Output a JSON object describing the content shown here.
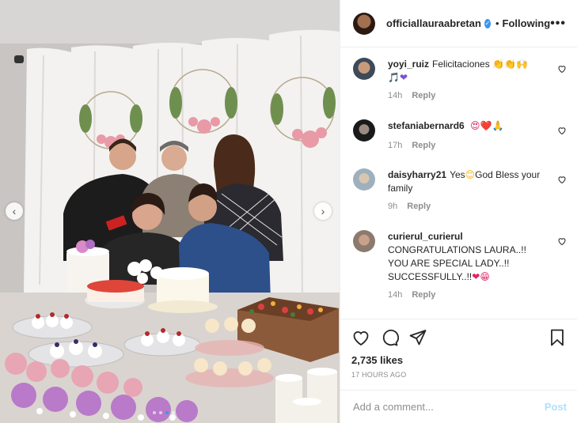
{
  "post": {
    "photo_alt": "",
    "carousel": {
      "prev": "‹",
      "next": "›"
    }
  },
  "header": {
    "username": "officiallauraabretan",
    "separator": "•",
    "follow_status": "Following",
    "more": "•••"
  },
  "comments": [
    {
      "user": "yoyi_ruiz",
      "text": "Felicitaciones",
      "emoji_after": "👏👏🙌",
      "line2": "🎵❤",
      "time": "14h",
      "reply": "Reply"
    },
    {
      "user": "stefaniabernard6",
      "text": "",
      "emoji_after": "😍❤️🙏",
      "line2": "",
      "time": "17h",
      "reply": "Reply"
    },
    {
      "user": "daisyharry21",
      "text": "Yes",
      "emoji_after": "😊",
      "text2": "God Bless your family",
      "time": "9h",
      "reply": "Reply"
    },
    {
      "user": "curierul_curierul",
      "text": "CONGRATULATIONS LAURA..!! YOU ARE SPECIAL LADY..!! SUCCESSFULLY..!!",
      "emoji_after": "❤😁",
      "time": "14h",
      "reply": "Reply"
    }
  ],
  "actions": {
    "likes": "2,735 likes",
    "timestamp": "17 HOURS AGO"
  },
  "add_comment": {
    "placeholder": "Add a comment...",
    "post_label": "Post"
  },
  "colors": {
    "link_blue": "#3897f0",
    "post_disabled": "#b2dffc",
    "meta_gray": "#8e8e8e",
    "text": "#262626"
  }
}
